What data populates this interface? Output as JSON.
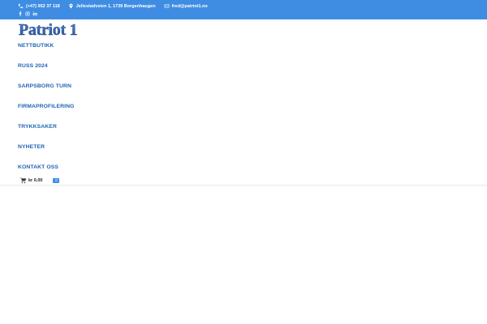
{
  "topbar": {
    "background": "#3f8de3",
    "phone": "(+47) 952 37 118",
    "address": "Jellestadveien 1, 1739 Borgenhaugen",
    "email": "fred@patriot1.no",
    "social": [
      "facebook-icon",
      "instagram-icon",
      "linkedin-icon"
    ]
  },
  "logo": {
    "text": "Patriot 1",
    "color": "#1f4f9a"
  },
  "nav": {
    "color": "#1f63b3",
    "items": [
      {
        "label": "NETTBUTIKK"
      },
      {
        "label": "RUSS 2024"
      },
      {
        "label": "SARPSBORG TURN"
      },
      {
        "label": "FIRMAPROFILERING"
      },
      {
        "label": "TRYKKSAKER"
      },
      {
        "label": "NYHETER"
      },
      {
        "label": "KONTAKT OSS"
      }
    ]
  },
  "cart": {
    "total": "kr 0,00",
    "count": "0",
    "icon": "cart-icon"
  }
}
